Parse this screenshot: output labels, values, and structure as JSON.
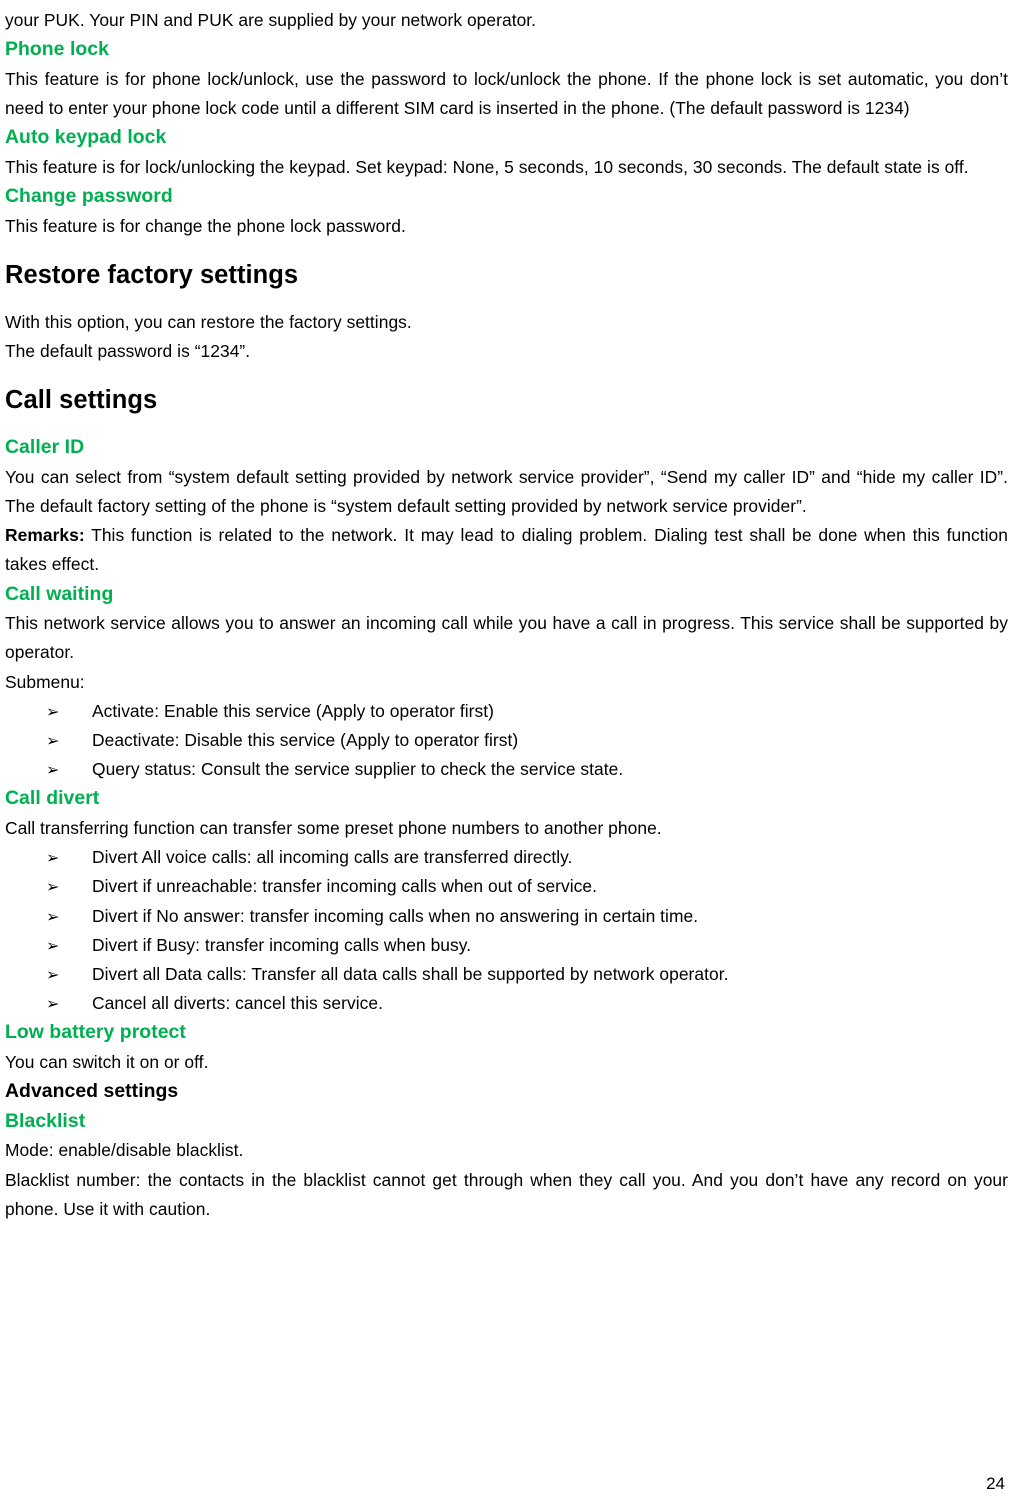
{
  "document": {
    "page_number": "24",
    "accent_color": "#00B050",
    "text_color": "#000000",
    "background_color": "#FFFFFF",
    "bullet_glyph": "➢"
  },
  "blocks": {
    "intro_continuation": "your PUK. Your PIN and PUK are supplied by your network operator.",
    "phone_lock_heading": "Phone lock",
    "phone_lock_body": "This feature is for phone lock/unlock, use the password to lock/unlock the phone. If the phone lock is set automatic, you don’t need to enter your phone lock code until a different SIM card is inserted in the phone. (The default password is 1234)",
    "auto_keypad_lock_heading": "Auto keypad lock",
    "auto_keypad_lock_body": "This feature is for lock/unlocking the keypad. Set keypad: None, 5 seconds, 10 seconds, 30 seconds. The default state is off.",
    "change_password_heading": "Change password",
    "change_password_body": "This feature is for change the phone lock password.",
    "restore_factory_heading": "Restore factory settings",
    "restore_factory_body_1": "With this option, you can restore the factory settings.",
    "restore_factory_body_2": "The default password is “1234”.",
    "call_settings_heading": "Call settings",
    "caller_id_heading": "Caller ID",
    "caller_id_body": "You can select from “system default setting provided by network service provider”, “Send my caller ID” and “hide my caller ID”. The default factory setting of the phone is “system default setting provided by network service provider”.",
    "caller_id_remarks_label": "Remarks:",
    "caller_id_remarks_body": " This function is related to the network. It may lead to dialing problem. Dialing test shall be done when this function takes effect.",
    "call_waiting_heading": "Call waiting",
    "call_waiting_body": "This network service allows you to answer an incoming call while you have a call in progress. This service shall be supported by operator.",
    "call_waiting_submenu_label": "Submenu:",
    "call_waiting_items": [
      "Activate: Enable this service (Apply to operator first)",
      "Deactivate: Disable this service (Apply to operator first)",
      "Query status: Consult the service supplier to check the service state."
    ],
    "call_divert_heading": "Call divert",
    "call_divert_body": "Call transferring function can transfer some preset phone numbers to another phone.",
    "call_divert_items": [
      "Divert All voice calls: all incoming calls are transferred directly.",
      "Divert if unreachable: transfer incoming calls when out of service.",
      "Divert if No answer: transfer incoming calls when no answering in certain time.",
      "Divert if Busy: transfer incoming calls when busy.",
      "Divert all Data calls: Transfer all data calls shall be supported by network operator.",
      "Cancel all diverts: cancel this service."
    ],
    "low_battery_heading": "Low battery protect",
    "low_battery_body": "You can switch it on or off.",
    "advanced_settings_heading": "Advanced settings",
    "blacklist_heading": "Blacklist",
    "blacklist_mode_body": "Mode: enable/disable blacklist.",
    "blacklist_number_body": "Blacklist number: the contacts in the blacklist cannot get through when they call you. And you don’t have any record on your phone. Use it with caution."
  }
}
